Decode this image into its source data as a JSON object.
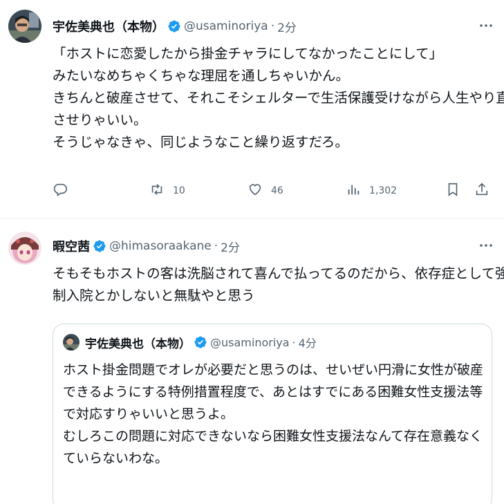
{
  "tweets": [
    {
      "display_name": "宇佐美典也（本物）",
      "handle": "@usaminoriya",
      "separator": "·",
      "time": "2分",
      "lines": [
        "「ホストに恋愛したから掛金チャラにしてなかったことにして」",
        "みたいなめちゃくちゃな理屈を通しちゃいかん。",
        "きちんと破産させて、それこそシェルターで生活保護受けながら人生やり直",
        "させりゃいい。",
        "そうじゃなきゃ、同じようなこと繰り返すだろ。"
      ],
      "actions": {
        "reply_icon": "reply-icon",
        "retweets": "10",
        "likes": "46",
        "views": "1,302",
        "bookmark_icon": "bookmark-icon",
        "share_icon": "share-icon"
      }
    },
    {
      "display_name": "暇空茜",
      "handle": "@himasoraakane",
      "separator": "·",
      "time": "2分",
      "lines": [
        "そもそもホストの客は洗脳されて喜んで払ってるのだから、依存症として強",
        "制入院とかしないと無駄やと思う"
      ],
      "quote": {
        "display_name": "宇佐美典也（本物）",
        "handle": "@usaminoriya",
        "separator": "·",
        "time": "4分",
        "lines": [
          "ホスト掛金問題でオレが必要だと思うのは、せいぜい円滑に女性が破産",
          "できるようにする特例措置程度で、あとはすでにある困難女性支援法等",
          "で対応すりゃいいと思うよ。",
          "むしろこの問題に対応できないなら困難女性支援法なんて存在意義なく",
          "ていらないわな。"
        ]
      }
    }
  ],
  "colors": {
    "verified_blue": "#1d9bf0",
    "secondary_text": "#536471",
    "primary_text": "#0f1419",
    "border": "#cfd9de"
  }
}
